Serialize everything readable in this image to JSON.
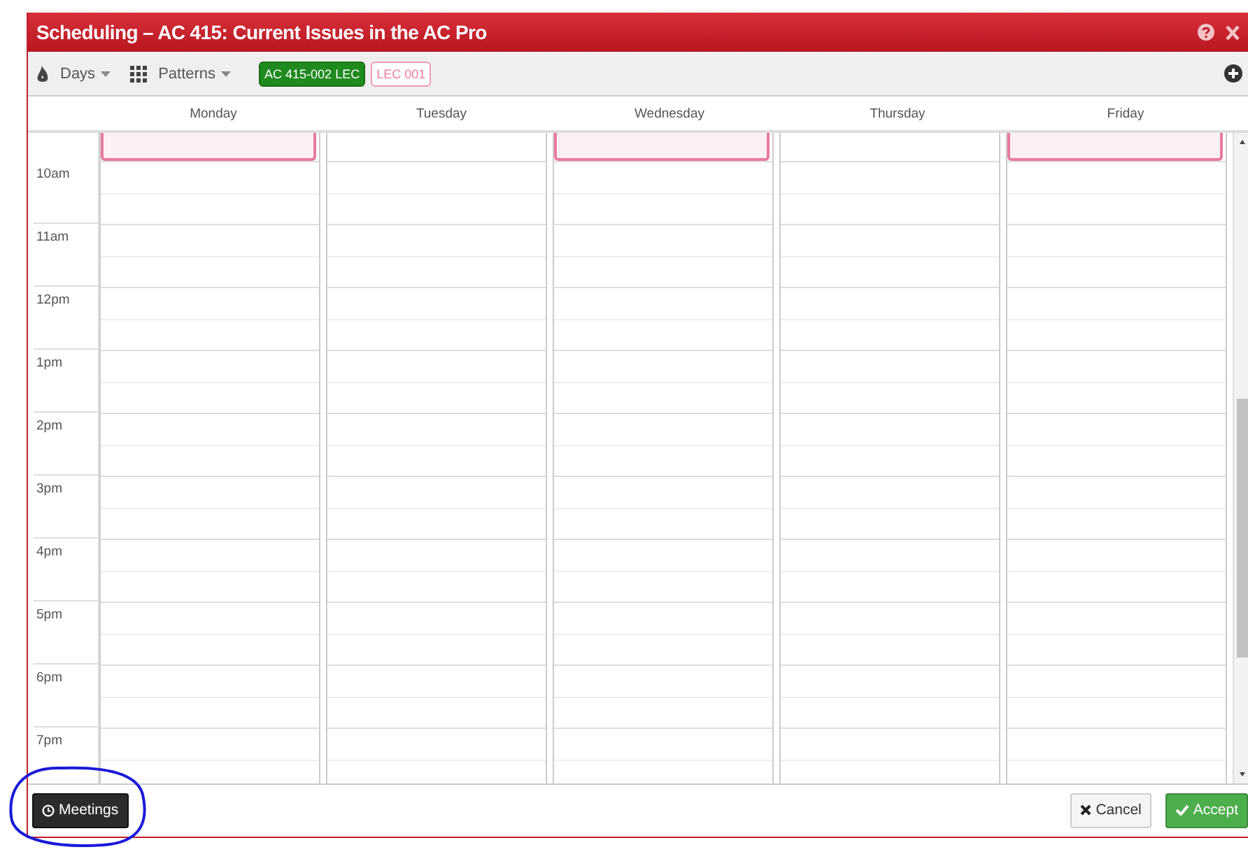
{
  "window": {
    "title": "Scheduling – AC 415: Current Issues in the AC Pro"
  },
  "toolbar": {
    "days_label": "Days",
    "patterns_label": "Patterns",
    "tags": [
      {
        "label": "AC 415-002 LEC",
        "selected": true
      },
      {
        "label": "LEC 001",
        "selected": false
      }
    ]
  },
  "calendar": {
    "days": [
      {
        "name": "Monday",
        "has_event": true
      },
      {
        "name": "Tuesday",
        "has_event": false
      },
      {
        "name": "Wednesday",
        "has_event": true
      },
      {
        "name": "Thursday",
        "has_event": false
      },
      {
        "name": "Friday",
        "has_event": true
      }
    ],
    "hours": [
      "10am",
      "11am",
      "12pm",
      "1pm",
      "2pm",
      "3pm",
      "4pm",
      "5pm",
      "6pm",
      "7pm"
    ]
  },
  "footer": {
    "meetings_label": "Meetings",
    "cancel_label": "Cancel",
    "accept_label": "Accept"
  }
}
